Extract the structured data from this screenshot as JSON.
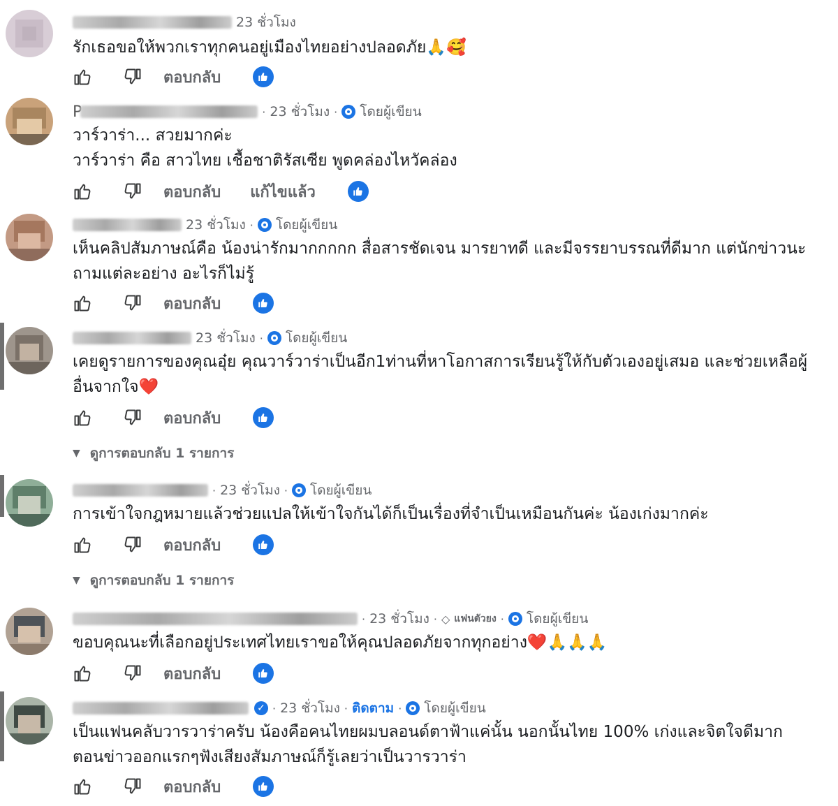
{
  "comments": [
    {
      "initial": "",
      "time": "23 ชั่วโมง",
      "follow": "",
      "author_label": "",
      "fan_badge": "",
      "text": "รักเธอขอให้พวกเราทุกคนอยู่เมืองไทยอย่างปลอดภัย🙏🥰",
      "reply_label": "ตอบกลับ",
      "edited_label": "",
      "view_replies": ""
    },
    {
      "initial": "P",
      "time": "23 ชั่วโมง",
      "follow": "",
      "author_label": "โดยผู้เขียน",
      "fan_badge": "",
      "text": "วาร์วาร่า... สวยมากค่ะ\nวาร์วาร่า คือ สาวไทย เชื้อชาติรัสเซีย พูดคล่องไหวัคล่อง",
      "reply_label": "ตอบกลับ",
      "edited_label": "แก้ไขแล้ว",
      "view_replies": ""
    },
    {
      "initial": "",
      "time": "23 ชั่วโมง",
      "follow": "",
      "author_label": "โดยผู้เขียน",
      "fan_badge": "",
      "text": "เห็นคลิปสัมภาษณ์คือ น้องน่ารักมากกกกก สื่อสารชัดเจน มารยาทดี และมีจรรยาบรรณที่ดีมาก แต่นักข่าวนะ ถามแต่ละอย่าง อะไรก็ไม่รู้",
      "reply_label": "ตอบกลับ",
      "edited_label": "",
      "view_replies": ""
    },
    {
      "initial": "",
      "time": "23 ชั่วโมง",
      "follow": "",
      "author_label": "โดยผู้เขียน",
      "fan_badge": "",
      "text": "เคยดูรายการของคุณอุ๋ย คุณวาร์วาร่าเป็นอีก1ท่านที่หาโอกาสการเรียนรู้ให้กับตัวเองอยู่เสมอ และช่วยเหลือผู้อื่นจากใจ❤️",
      "reply_label": "ตอบกลับ",
      "edited_label": "",
      "view_replies": "ดูการตอบกลับ 1 รายการ"
    },
    {
      "initial": "",
      "time": "23 ชั่วโมง",
      "follow": "",
      "author_label": "โดยผู้เขียน",
      "fan_badge": "",
      "text": "การเข้าใจกฎหมายแล้วช่วยแปลให้เข้าใจกันได้ก็เป็นเรื่องที่จำเป็นเหมือนกันค่ะ น้องเก่งมากค่ะ",
      "reply_label": "ตอบกลับ",
      "edited_label": "",
      "view_replies": "ดูการตอบกลับ 1 รายการ"
    },
    {
      "initial": "",
      "time": "23 ชั่วโมง",
      "follow": "",
      "author_label": "โดยผู้เขียน",
      "fan_badge": "แฟนตัวยง",
      "text": "ขอบคุณนะที่เลือกอยู่ประเทศไทยเราขอให้คุณปลอดภัยจากทุกอย่าง❤️🙏🙏🙏",
      "reply_label": "ตอบกลับ",
      "edited_label": "",
      "view_replies": ""
    },
    {
      "initial": "",
      "time": "23 ชั่วโมง",
      "follow": "ติดตาม",
      "author_label": "โดยผู้เขียน",
      "fan_badge": "",
      "text": "เป็นแฟนคลับวารวาร่าครับ น้องคือคนไทยผมบลอนด์ตาฟ้าแค่นั้น นอกนั้นไทย 100% เก่งและจิตใจดีมาก ตอนข่าวออกแรกๆฟังเสียงสัมภาษณ์ก็รู้เลยว่าเป็นวารวาร่า",
      "reply_label": "ตอบกลับ",
      "edited_label": "",
      "view_replies": ""
    }
  ],
  "colors": {
    "text": "#1c1e21",
    "meta": "#65676b",
    "accent": "#1b74e4"
  },
  "icons": [
    "thumbs-up-icon",
    "thumbs-down-icon",
    "like-reaction-icon",
    "author-badge-icon",
    "verified-icon",
    "fan-diamond-icon",
    "chevron-down-icon"
  ]
}
